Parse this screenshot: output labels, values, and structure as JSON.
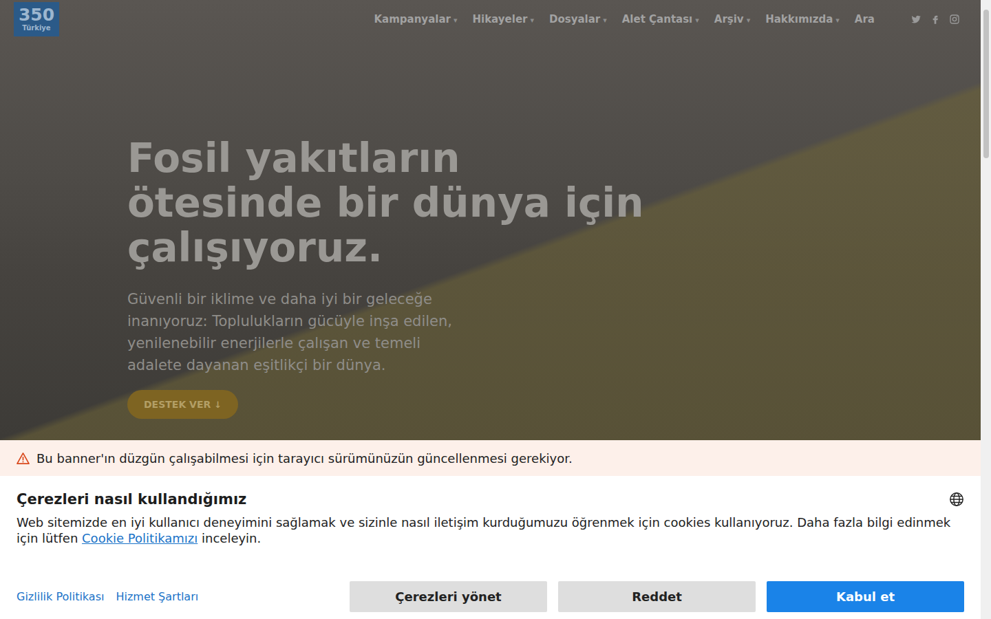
{
  "logo": {
    "number": "350",
    "country": "Türkiye"
  },
  "nav": {
    "caret": "▾",
    "items": [
      {
        "label": "Kampanyalar",
        "has_menu": true
      },
      {
        "label": "Hikayeler",
        "has_menu": true
      },
      {
        "label": "Dosyalar",
        "has_menu": true
      },
      {
        "label": "Alet Çantası",
        "has_menu": true
      },
      {
        "label": "Arşiv",
        "has_menu": true
      },
      {
        "label": "Hakkımızda",
        "has_menu": true
      },
      {
        "label": "Ara",
        "has_menu": false
      }
    ]
  },
  "hero": {
    "title": "Fosil yakıtların ötesinde bir dünya için çalışıyoruz.",
    "text": "Güvenli bir iklime ve daha iyi bir geleceğe inanıyoruz: Toplulukların gücüyle inşa edilen, yenilenebilir enerjilerle çalışan ve temeli adalete dayanan eşitlikçi bir dünya.",
    "button": {
      "label": "DESTEK VER",
      "icon": "↓"
    }
  },
  "cookie_banner": {
    "warning": "Bu banner'ın düzgün çalışabilmesi için tarayıcı sürümünüzün güncellenmesi gerekiyor.",
    "title": "Çerezleri nasıl kullandığımız",
    "text_before": "Web sitemizde en iyi kullanıcı deneyimini sağlamak ve sizinle nasıl iletişim kurduğumuzu öğrenmek için cookies kullanıyoruz. Daha fazla bilgi edinmek için lütfen ",
    "policy_link": "Cookie Politikamızı",
    "text_after": " inceleyin.",
    "links": [
      "Gizlilik Politikası",
      "Hizmet Şartları"
    ],
    "buttons": [
      {
        "label": "Çerezleri yönet",
        "kind": "secondary"
      },
      {
        "label": "Reddet",
        "kind": "secondary"
      },
      {
        "label": "Kabul et",
        "kind": "primary"
      }
    ]
  }
}
